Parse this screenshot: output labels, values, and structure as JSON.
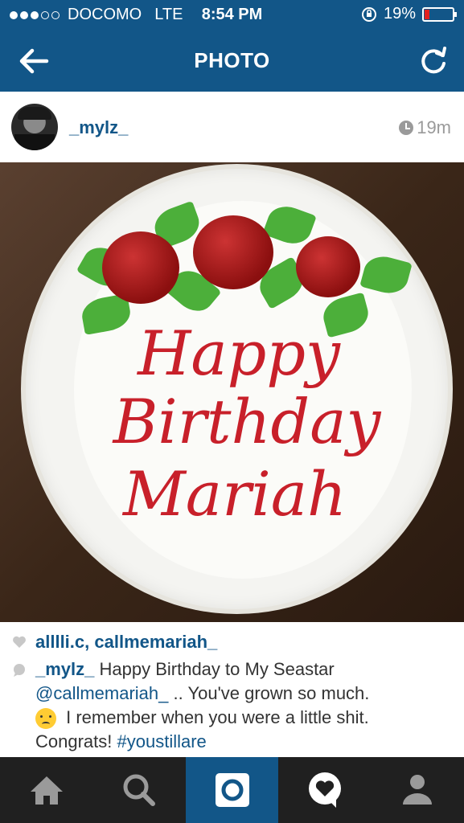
{
  "status_bar": {
    "carrier": "DOCOMO",
    "network": "LTE",
    "time": "8:54 PM",
    "battery_percent": "19%",
    "battery_level": 0.19,
    "signal_bars_filled": 3,
    "signal_bars_total": 5,
    "lock_icon": "rotation-lock-icon"
  },
  "navbar": {
    "title": "PHOTO",
    "back_icon": "back-arrow-icon",
    "refresh_icon": "refresh-icon"
  },
  "post": {
    "username": "_mylz_",
    "time_ago": "19m",
    "photo_description_hidden": "",
    "cake_text": [
      "Happy",
      "Birthday",
      "Mariah"
    ]
  },
  "likes": {
    "names": "alllli.c, callmemariah_"
  },
  "caption": {
    "user": "_mylz_",
    "text1": " Happy Birthday to My Seastar ",
    "mention": "@callmemariah_",
    "text2": " .. You've grown so much. ",
    "text3": " I remember when you were a little shit. Congrats! ",
    "hashtag": "#youstillare"
  },
  "tabs": [
    {
      "icon": "home-icon",
      "active": false
    },
    {
      "icon": "search-icon",
      "active": false
    },
    {
      "icon": "camera-icon",
      "active": true
    },
    {
      "icon": "activity-heart-icon",
      "active": false
    },
    {
      "icon": "profile-icon",
      "active": false
    }
  ],
  "colors": {
    "brand": "#125688",
    "tabbar": "#202020",
    "battery_low": "#e02020"
  }
}
